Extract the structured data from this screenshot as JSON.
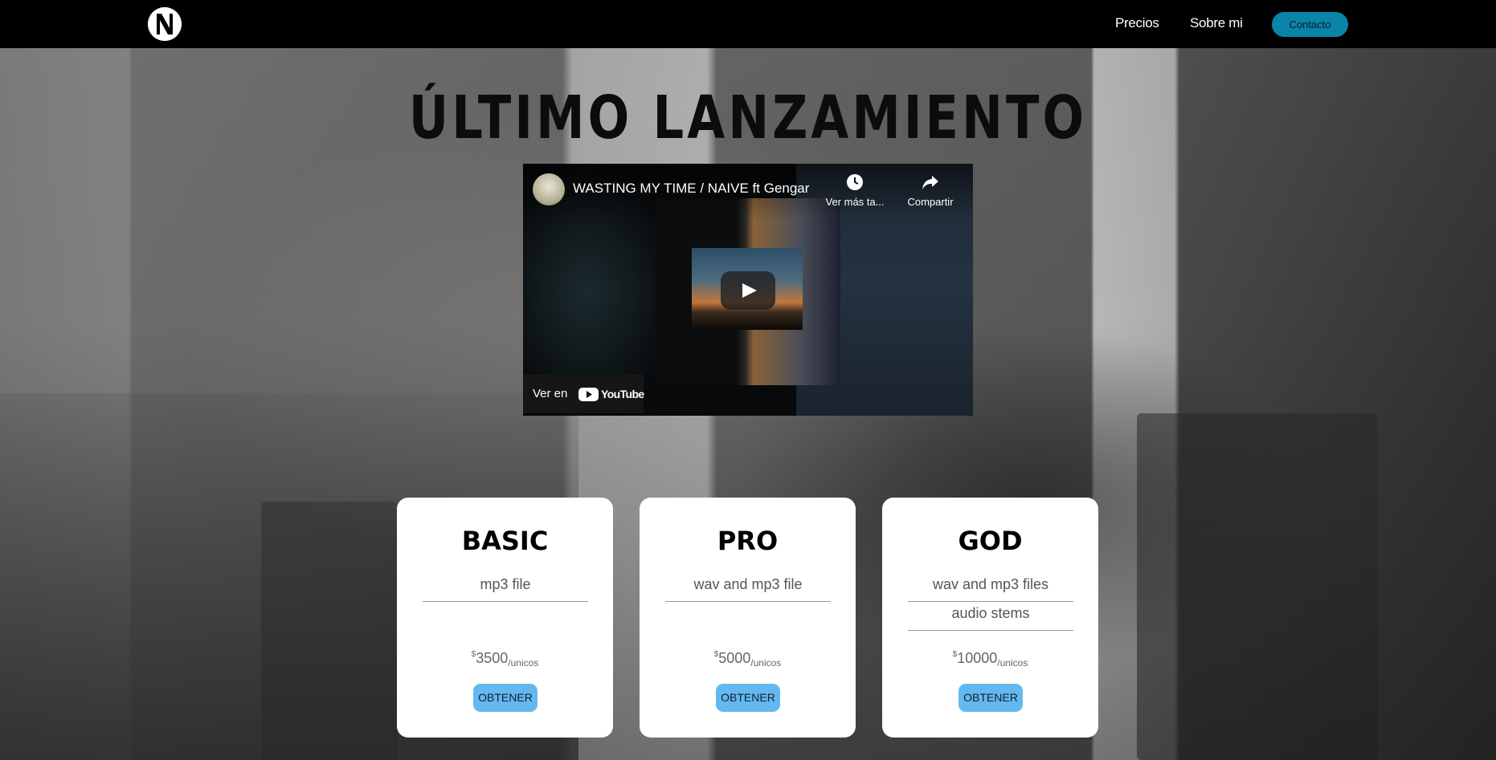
{
  "nav": {
    "logo_letter": "N",
    "links": [
      "Precios",
      "Sobre mi"
    ],
    "contact_label": "Contacto",
    "accent_color": "#0a85a8"
  },
  "hero": {
    "heading": "ÚLTIMO LANZAMIENTO"
  },
  "video": {
    "title": "WASTING MY TIME / NAIVE ft Gengar",
    "watch_later_label": "Ver más ta...",
    "share_label": "Compartir",
    "watch_on_label": "Ver en",
    "youtube_word": "YouTube",
    "icons": [
      "clock-icon",
      "share-icon",
      "play-icon",
      "youtube-icon"
    ]
  },
  "plans": [
    {
      "name": "BASIC",
      "features": [
        "mp3 file"
      ],
      "currency": "$",
      "price": "3500",
      "period": "/unicos",
      "button": "OBTENER"
    },
    {
      "name": "PRO",
      "features": [
        "wav and mp3 file"
      ],
      "currency": "$",
      "price": "5000",
      "period": "/unicos",
      "button": "OBTENER"
    },
    {
      "name": "GOD",
      "features": [
        "wav and mp3 files",
        "audio stems"
      ],
      "currency": "$",
      "price": "10000",
      "period": "/unicos",
      "button": "OBTENER"
    }
  ],
  "colors": {
    "button": "#64b8ef",
    "nav_bg": "#000000"
  }
}
